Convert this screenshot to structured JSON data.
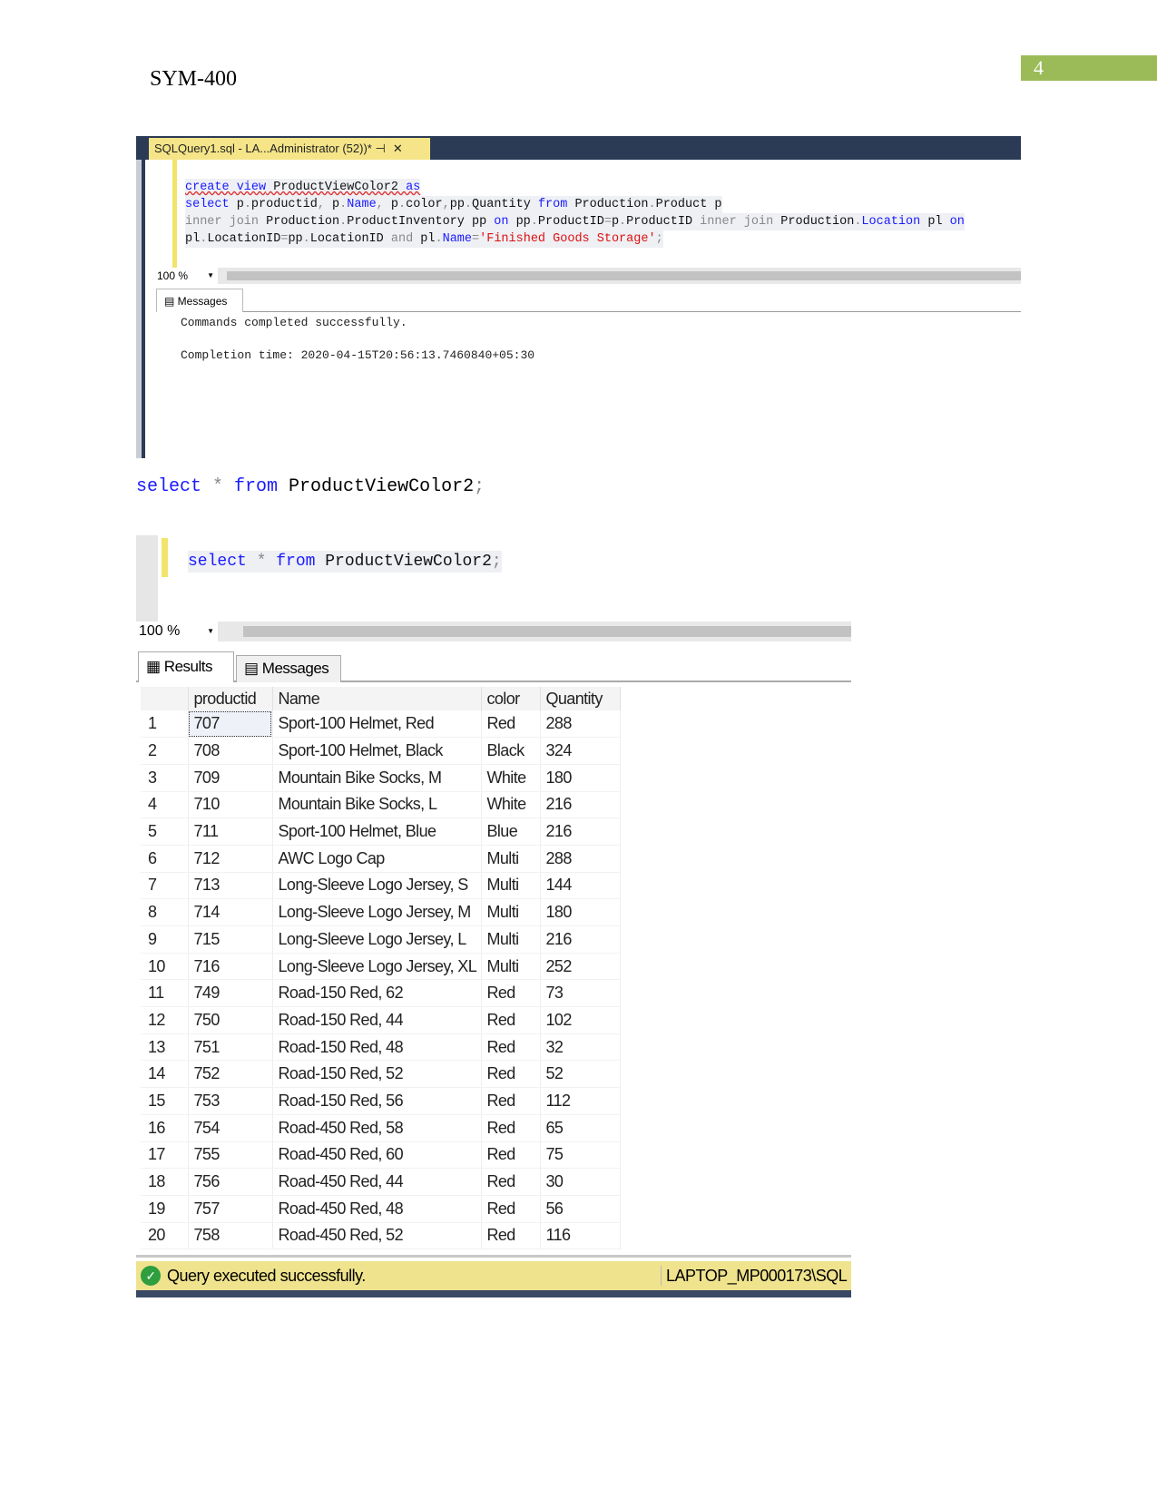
{
  "page": {
    "header": "SYM-400",
    "page_number": "4",
    "accent": "#9bbb59"
  },
  "screenshot1": {
    "tab_title": "SQLQuery1.sql - LA...Administrator (52))*",
    "tab_pin": "⊣",
    "tab_close": "✕",
    "code": [
      [
        {
          "t": "create view",
          "c": "kw"
        },
        {
          "t": " ProductViewColor2 ",
          "c": ""
        },
        {
          "t": "as",
          "c": "kw"
        }
      ],
      [
        {
          "t": "select",
          "c": "kw"
        },
        {
          "t": " p",
          "c": ""
        },
        {
          "t": ".",
          "c": "gr"
        },
        {
          "t": "productid",
          "c": ""
        },
        {
          "t": ",",
          "c": "gr"
        },
        {
          "t": " p",
          "c": ""
        },
        {
          "t": ".",
          "c": "gr"
        },
        {
          "t": "Name",
          "c": "kw"
        },
        {
          "t": ",",
          "c": "gr"
        },
        {
          "t": " p",
          "c": ""
        },
        {
          "t": ".",
          "c": "gr"
        },
        {
          "t": "color",
          "c": ""
        },
        {
          "t": ",",
          "c": "gr"
        },
        {
          "t": "pp",
          "c": ""
        },
        {
          "t": ".",
          "c": "gr"
        },
        {
          "t": "Quantity ",
          "c": ""
        },
        {
          "t": "from",
          "c": "kw"
        },
        {
          "t": " Production",
          "c": ""
        },
        {
          "t": ".",
          "c": "gr"
        },
        {
          "t": "Product p",
          "c": ""
        }
      ],
      [
        {
          "t": "inner join",
          "c": "gr"
        },
        {
          "t": " Production",
          "c": ""
        },
        {
          "t": ".",
          "c": "gr"
        },
        {
          "t": "ProductInventory pp ",
          "c": ""
        },
        {
          "t": "on",
          "c": "kw"
        },
        {
          "t": " pp",
          "c": ""
        },
        {
          "t": ".",
          "c": "gr"
        },
        {
          "t": "ProductID",
          "c": ""
        },
        {
          "t": "=",
          "c": "gr"
        },
        {
          "t": "p",
          "c": ""
        },
        {
          "t": ".",
          "c": "gr"
        },
        {
          "t": "ProductID ",
          "c": ""
        },
        {
          "t": "inner join",
          "c": "gr"
        },
        {
          "t": " Production",
          "c": ""
        },
        {
          "t": ".",
          "c": "gr"
        },
        {
          "t": "Location",
          "c": "kw"
        },
        {
          "t": " pl ",
          "c": ""
        },
        {
          "t": "on",
          "c": "kw"
        }
      ],
      [
        {
          "t": "pl",
          "c": ""
        },
        {
          "t": ".",
          "c": "gr"
        },
        {
          "t": "LocationID",
          "c": ""
        },
        {
          "t": "=",
          "c": "gr"
        },
        {
          "t": "pp",
          "c": ""
        },
        {
          "t": ".",
          "c": "gr"
        },
        {
          "t": "LocationID ",
          "c": ""
        },
        {
          "t": "and",
          "c": "gr"
        },
        {
          "t": " pl",
          "c": ""
        },
        {
          "t": ".",
          "c": "gr"
        },
        {
          "t": "Name",
          "c": "kw"
        },
        {
          "t": "=",
          "c": "gr"
        },
        {
          "t": "'Finished Goods Storage'",
          "c": "st"
        },
        {
          "t": ";",
          "c": "gr"
        }
      ]
    ],
    "zoom": "100 %",
    "messages_tab": "Messages",
    "message_1": "Commands completed successfully.",
    "message_2": "Completion time: 2020-04-15T20:56:13.7460840+05:30"
  },
  "doc_query": [
    {
      "t": "select",
      "c": "kw"
    },
    {
      "t": " * ",
      "c": "gr"
    },
    {
      "t": "from",
      "c": "kw"
    },
    {
      "t": " ProductViewColor2",
      "c": ""
    },
    {
      "t": ";",
      "c": "gr"
    }
  ],
  "screenshot2": {
    "zoom": "100 %",
    "tabs": {
      "results": "Results",
      "messages": "Messages"
    },
    "columns": [
      "",
      "productid",
      "Name",
      "color",
      "Quantity"
    ],
    "rows": [
      [
        "1",
        "707",
        "Sport-100 Helmet, Red",
        "Red",
        "288"
      ],
      [
        "2",
        "708",
        "Sport-100 Helmet, Black",
        "Black",
        "324"
      ],
      [
        "3",
        "709",
        "Mountain Bike Socks, M",
        "White",
        "180"
      ],
      [
        "4",
        "710",
        "Mountain Bike Socks, L",
        "White",
        "216"
      ],
      [
        "5",
        "711",
        "Sport-100 Helmet, Blue",
        "Blue",
        "216"
      ],
      [
        "6",
        "712",
        "AWC Logo Cap",
        "Multi",
        "288"
      ],
      [
        "7",
        "713",
        "Long-Sleeve Logo Jersey, S",
        "Multi",
        "144"
      ],
      [
        "8",
        "714",
        "Long-Sleeve Logo Jersey, M",
        "Multi",
        "180"
      ],
      [
        "9",
        "715",
        "Long-Sleeve Logo Jersey, L",
        "Multi",
        "216"
      ],
      [
        "10",
        "716",
        "Long-Sleeve Logo Jersey, XL",
        "Multi",
        "252"
      ],
      [
        "11",
        "749",
        "Road-150 Red, 62",
        "Red",
        "73"
      ],
      [
        "12",
        "750",
        "Road-150 Red, 44",
        "Red",
        "102"
      ],
      [
        "13",
        "751",
        "Road-150 Red, 48",
        "Red",
        "32"
      ],
      [
        "14",
        "752",
        "Road-150 Red, 52",
        "Red",
        "52"
      ],
      [
        "15",
        "753",
        "Road-150 Red, 56",
        "Red",
        "112"
      ],
      [
        "16",
        "754",
        "Road-450 Red, 58",
        "Red",
        "65"
      ],
      [
        "17",
        "755",
        "Road-450 Red, 60",
        "Red",
        "75"
      ],
      [
        "18",
        "756",
        "Road-450 Red, 44",
        "Red",
        "30"
      ],
      [
        "19",
        "757",
        "Road-450 Red, 48",
        "Red",
        "56"
      ],
      [
        "20",
        "758",
        "Road-450 Red, 52",
        "Red",
        "116"
      ]
    ],
    "status": "Query executed successfully.",
    "server": "LAPTOP_MP000173\\SQL"
  }
}
